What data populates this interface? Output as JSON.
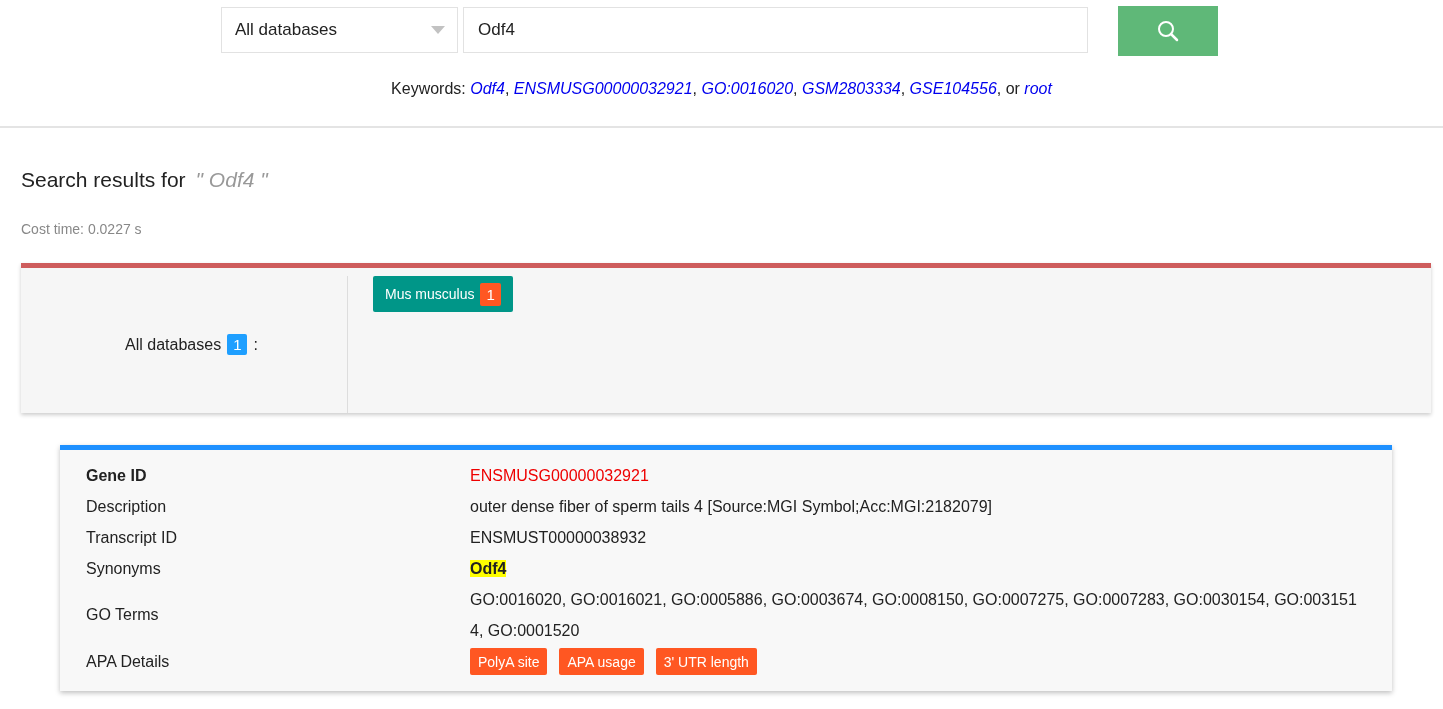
{
  "search": {
    "database": "All databases",
    "query": "Odf4"
  },
  "keywords": [
    {
      "kind": "text",
      "text": "Keywords: "
    },
    {
      "kind": "link",
      "text": "Odf4"
    },
    {
      "kind": "text",
      "text": ", "
    },
    {
      "kind": "link",
      "text": "ENSMUSG00000032921"
    },
    {
      "kind": "text",
      "text": ", "
    },
    {
      "kind": "link",
      "text": "GO:0016020"
    },
    {
      "kind": "text",
      "text": ", "
    },
    {
      "kind": "link",
      "text": "GSM2803334"
    },
    {
      "kind": "text",
      "text": ", "
    },
    {
      "kind": "link",
      "text": "GSE104556"
    },
    {
      "kind": "text",
      "text": ", or "
    },
    {
      "kind": "link",
      "text": "root"
    }
  ],
  "results": {
    "title": "Search results for",
    "query": "\" Odf4 \"",
    "cost_time": "Cost time: 0.0227 s"
  },
  "summary": {
    "label": "All databases",
    "count": "1",
    "separator": ":",
    "species": [
      {
        "name": "Mus musculus",
        "count": "1"
      }
    ]
  },
  "gene": {
    "rows": [
      {
        "kind": "id",
        "label": "Gene ID",
        "value": "ENSMUSG00000032921"
      },
      {
        "kind": "text",
        "label": "Description",
        "value": "outer dense fiber of sperm tails 4 [Source:MGI Symbol;Acc:MGI:2182079]"
      },
      {
        "kind": "text",
        "label": "Transcript ID",
        "value": "ENSMUST00000038932"
      },
      {
        "kind": "highlight",
        "label": "Synonyms",
        "value": "Odf4"
      },
      {
        "kind": "wrap",
        "label": "GO Terms",
        "value": "GO:0016020, GO:0016021, GO:0005886, GO:0003674, GO:0008150, GO:0007275, GO:0007283, GO:0030154, GO:0031514, GO:0001520"
      },
      {
        "kind": "buttons",
        "label": "APA Details",
        "buttons": [
          "PolyA site",
          "APA usage",
          "3' UTR length"
        ]
      }
    ]
  }
}
